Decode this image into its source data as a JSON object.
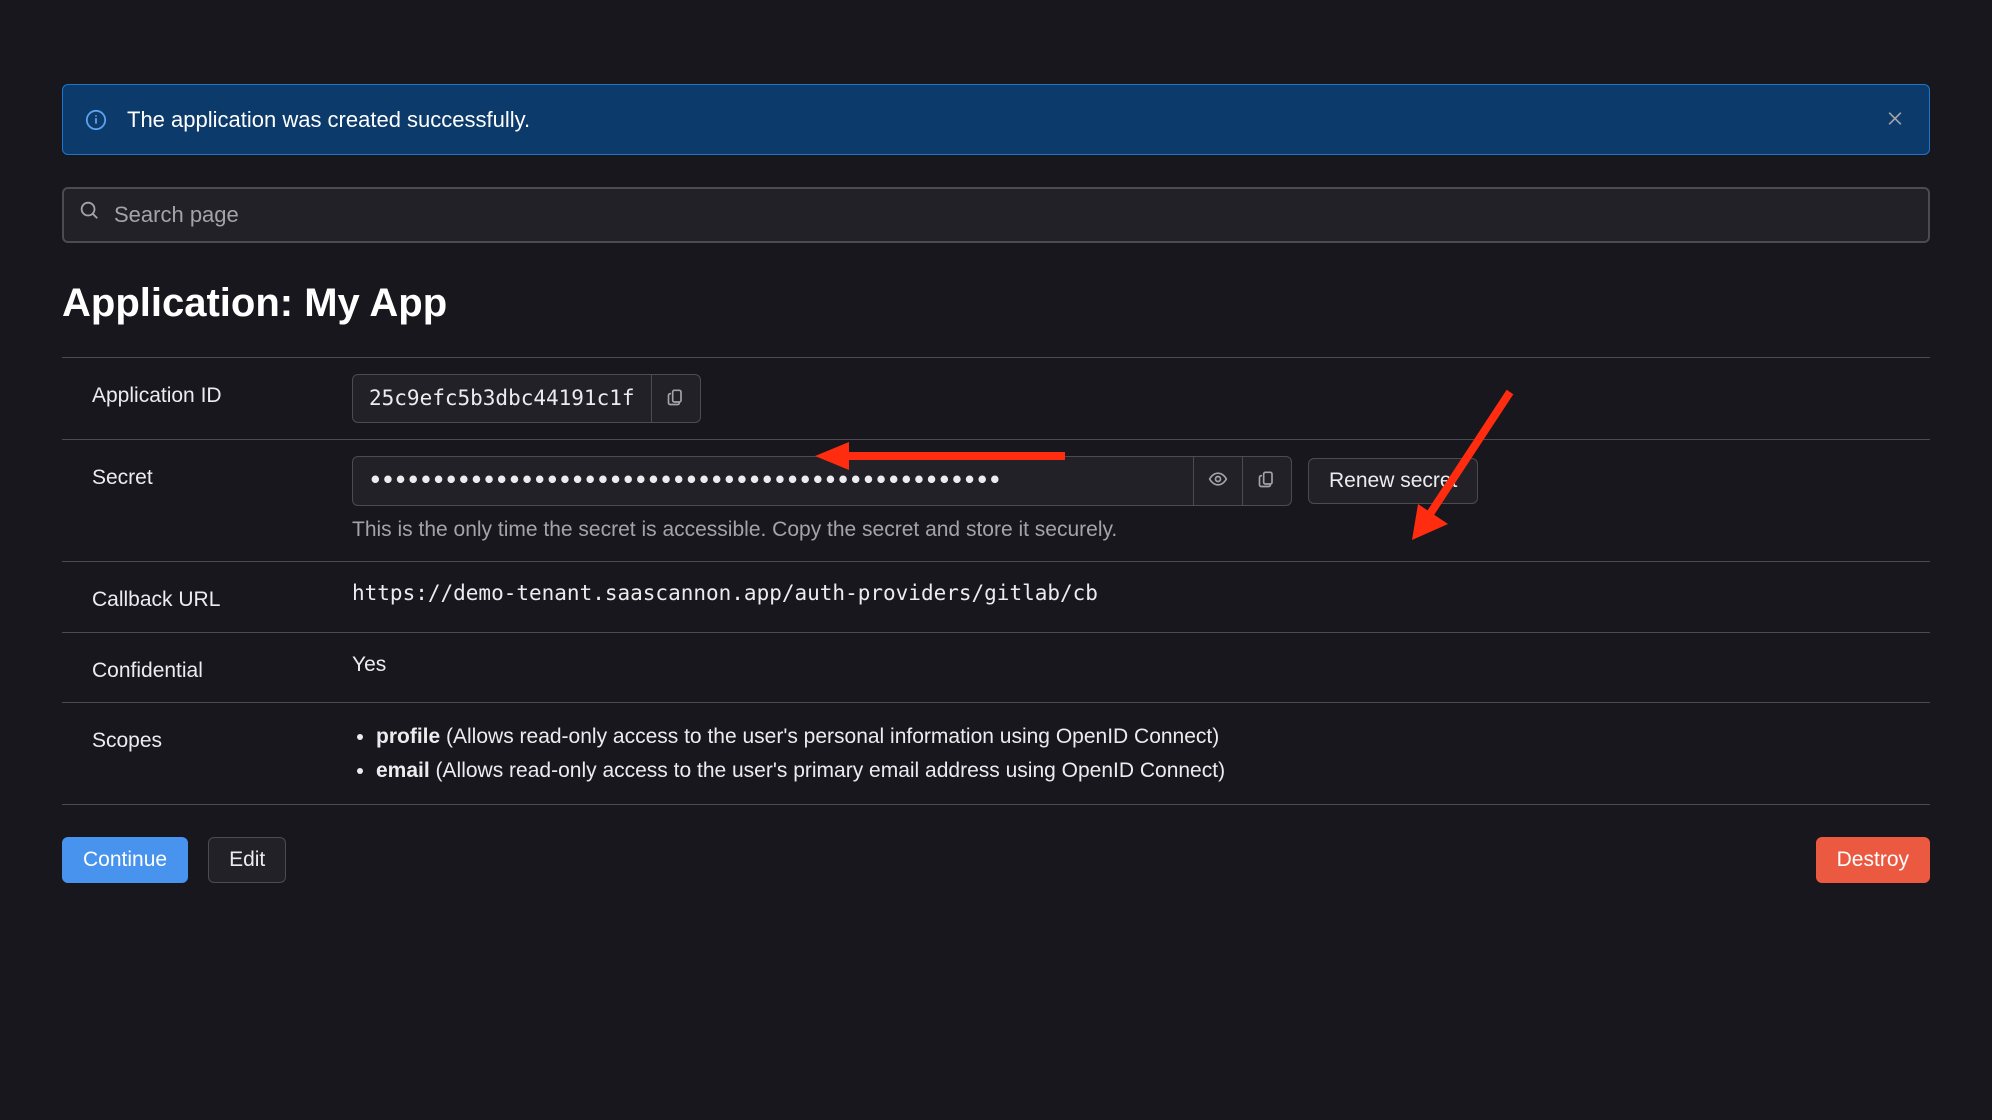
{
  "alert": {
    "message": "The application was created successfully."
  },
  "search": {
    "placeholder": "Search page"
  },
  "page_title": "Application: My App",
  "labels": {
    "application_id": "Application ID",
    "secret": "Secret",
    "callback_url": "Callback URL",
    "confidential": "Confidential",
    "scopes": "Scopes"
  },
  "application_id": "25c9efc5b3dbc44191c1f",
  "secret_masked": "••••••••••••••••••••••••••••••••••••••••••••••••••",
  "secret_help": "This is the only time the secret is accessible. Copy the secret and store it securely.",
  "renew_secret_label": "Renew secret",
  "callback_url": "https://demo-tenant.saascannon.app/auth-providers/gitlab/cb",
  "confidential": "Yes",
  "scopes": [
    {
      "name": "profile",
      "desc": "(Allows read-only access to the user's personal information using OpenID Connect)"
    },
    {
      "name": "email",
      "desc": "(Allows read-only access to the user's primary email address using OpenID Connect)"
    }
  ],
  "buttons": {
    "continue": "Continue",
    "edit": "Edit",
    "destroy": "Destroy"
  }
}
